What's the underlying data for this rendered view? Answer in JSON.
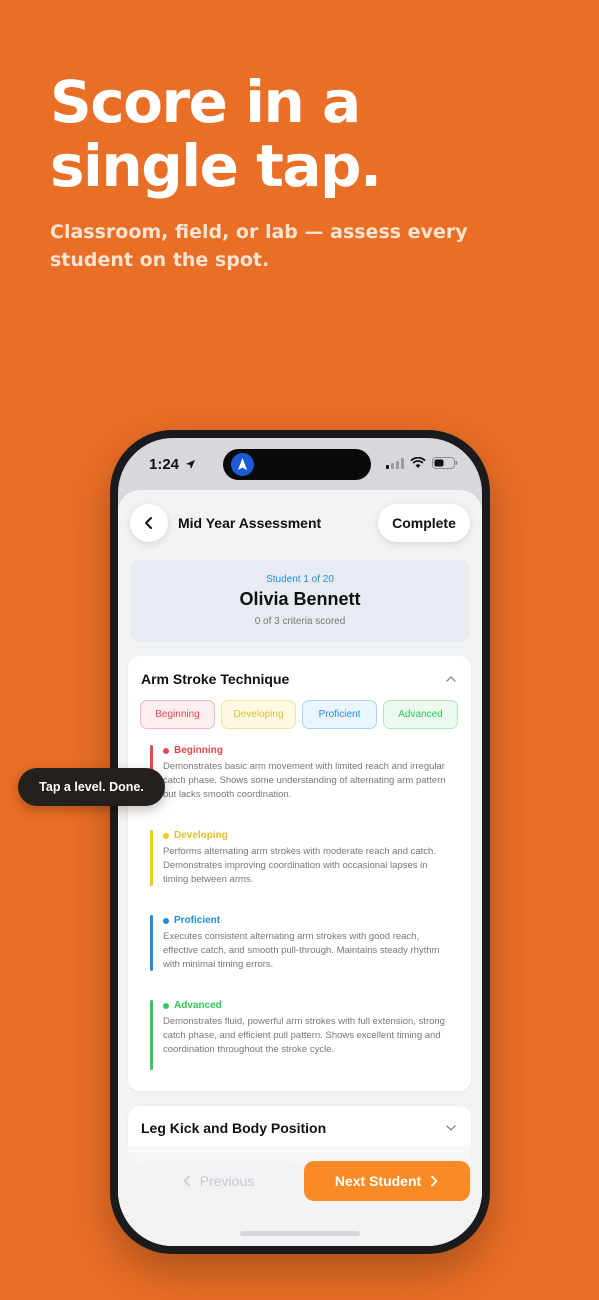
{
  "marketing": {
    "headline_line1": "Score in a",
    "headline_line2": "single tap.",
    "subtitle": "Classroom, field, or lab — assess every student on the spot."
  },
  "statusbar": {
    "time": "1:24",
    "icons": [
      "location-arrow-icon",
      "signal-icon",
      "wifi-icon",
      "battery-icon"
    ]
  },
  "nav": {
    "title": "Mid Year Assessment",
    "complete_label": "Complete",
    "back_icon": "chevron-left-icon"
  },
  "student": {
    "counter": "Student 1 of 20",
    "name": "Olivia Bennett",
    "criteria_scored": "0 of 3 criteria scored"
  },
  "criterion1": {
    "title": "Arm Stroke Technique",
    "expanded": true,
    "chips": [
      {
        "label": "Beginning",
        "color": "#E5484D"
      },
      {
        "label": "Developing",
        "color": "#F2C81B"
      },
      {
        "label": "Proficient",
        "color": "#1E8BE0"
      },
      {
        "label": "Advanced",
        "color": "#34C759"
      }
    ],
    "levels": [
      {
        "name": "Beginning",
        "description": "Demonstrates basic arm movement with limited reach and irregular catch phase. Shows some understanding of alternating arm pattern but lacks smooth coordination."
      },
      {
        "name": "Developing",
        "description": "Performs alternating arm strokes with moderate reach and catch. Demonstrates improving coordination with occasional lapses in timing between arms."
      },
      {
        "name": "Proficient",
        "description": "Executes consistent alternating arm strokes with good reach, effective catch, and smooth pull-through. Maintains steady rhythm with minimal timing errors."
      },
      {
        "name": "Advanced",
        "description": "Demonstrates fluid, powerful arm strokes with full extension, strong catch phase, and efficient pull pattern. Shows excellent timing and coordination throughout the stroke cycle."
      }
    ]
  },
  "criterion2": {
    "title": "Leg Kick and Body Position",
    "expanded": false
  },
  "footer": {
    "previous_label": "Previous",
    "next_label": "Next Student"
  },
  "tooltip": "Tap a level. Done.",
  "colors": {
    "background": "#E96E26",
    "accent": "#FA8A26"
  }
}
